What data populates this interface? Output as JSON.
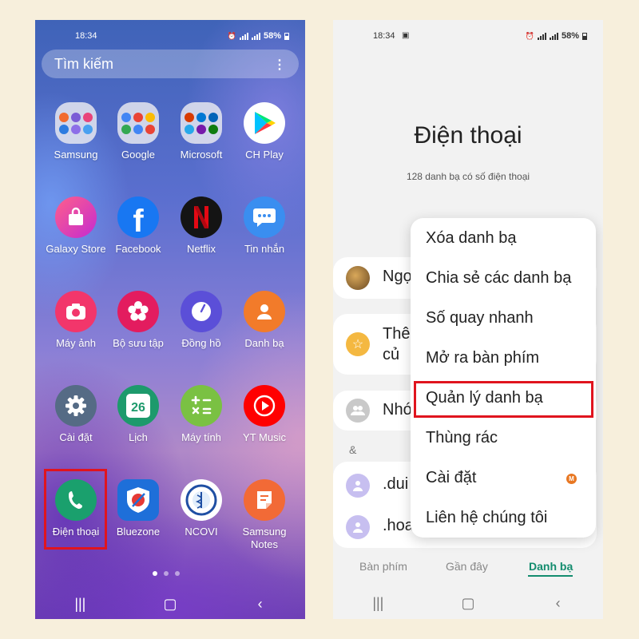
{
  "left_phone": {
    "status_bar": {
      "time": "18:34",
      "battery": "58%"
    },
    "search": {
      "label": "Tìm kiếm"
    },
    "apps": [
      {
        "name": "Samsung"
      },
      {
        "name": "Google"
      },
      {
        "name": "Microsoft"
      },
      {
        "name": "CH Play"
      },
      {
        "name": "Galaxy Store"
      },
      {
        "name": "Facebook"
      },
      {
        "name": "Netflix"
      },
      {
        "name": "Tin nhắn"
      },
      {
        "name": "Máy ảnh"
      },
      {
        "name": "Bộ sưu tập"
      },
      {
        "name": "Đồng hồ"
      },
      {
        "name": "Danh bạ"
      },
      {
        "name": "Cài đặt"
      },
      {
        "name": "Lịch"
      },
      {
        "name": "Máy tính"
      },
      {
        "name": "YT Music"
      },
      {
        "name": "Điện thoại"
      },
      {
        "name": "Bluezone"
      },
      {
        "name": "NCOVI"
      },
      {
        "name": "Samsung Notes"
      }
    ],
    "calendar_day": "26",
    "highlighted_app": "Điện thoại"
  },
  "right_phone": {
    "status_bar": {
      "time": "18:34",
      "battery": "58%"
    },
    "title": "Điện thoại",
    "subtitle": "128 danh bạ có số điện thoại",
    "rows": {
      "profile": "Ngọ",
      "favorites_line1": "Thê",
      "favorites_line2": "củ",
      "groups": "Nhó",
      "section_letter": "&",
      "contact_1": ".dui",
      "contact_2": ".hoa"
    },
    "menu": {
      "items": [
        {
          "label": "Xóa danh bạ"
        },
        {
          "label": "Chia sẻ các danh bạ"
        },
        {
          "label": "Số quay nhanh"
        },
        {
          "label": "Mở ra bàn phím"
        },
        {
          "label": "Quản lý danh bạ"
        },
        {
          "label": "Thùng rác"
        },
        {
          "label": "Cài đặt"
        },
        {
          "label": "Liên hệ chúng tôi"
        }
      ],
      "badge": "M",
      "highlighted_item": "Quản lý danh bạ"
    },
    "tabs": [
      {
        "label": "Bàn phím"
      },
      {
        "label": "Gần đây"
      },
      {
        "label": "Danh bạ"
      }
    ],
    "active_tab": "Danh bạ"
  },
  "colors": {
    "highlight_red": "#e0141e",
    "accent_green": "#138c6e",
    "phone_app_green": "#1aa06d",
    "background": "#f7efdc"
  }
}
